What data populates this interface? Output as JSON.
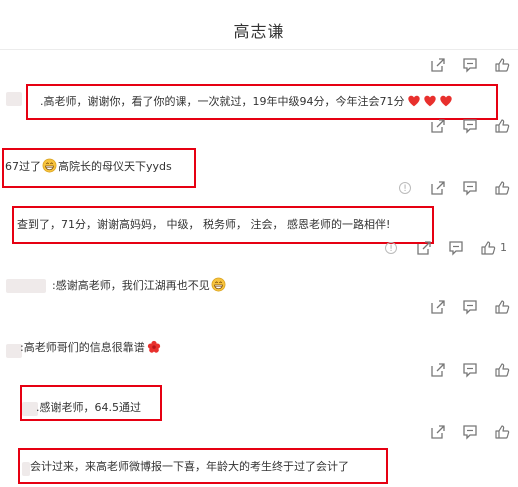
{
  "header": {
    "title": "高志谦"
  },
  "comments": [
    {
      "text": ".高老师，谢谢你，看了你的课，一次就过，19年中级94分，今年注会71分",
      "likes": ""
    },
    {
      "text_a": "67过了",
      "text_b": "高院长的母仪天下yyds",
      "likes": ""
    },
    {
      "text": "查到了，71分，谢谢高妈妈， 中级， 税务师， 注会， 感恩老师的一路相伴!",
      "likes": "1"
    },
    {
      "text": ":感谢高老师，我们江湖再也不见",
      "likes": ""
    },
    {
      "text": ":高老师哥们的信息很靠谱",
      "likes": ""
    },
    {
      "text": ".感谢老师，64.5通过",
      "likes": ""
    },
    {
      "text": "会计过来，来高老师微博报一下喜，年龄大的考生终于过了会计了",
      "likes": ""
    }
  ],
  "icons": {
    "share": "share-icon",
    "comment": "comment-icon",
    "like": "thumbs-up-icon",
    "report": "report-icon",
    "heart": "heart-emoji-icon",
    "smile": "grin-emoji-icon",
    "flower": "flower-emoji-icon"
  },
  "colors": {
    "highlight": "#e60012",
    "heart": "#e8302d",
    "emoji": "#f7c33d"
  }
}
